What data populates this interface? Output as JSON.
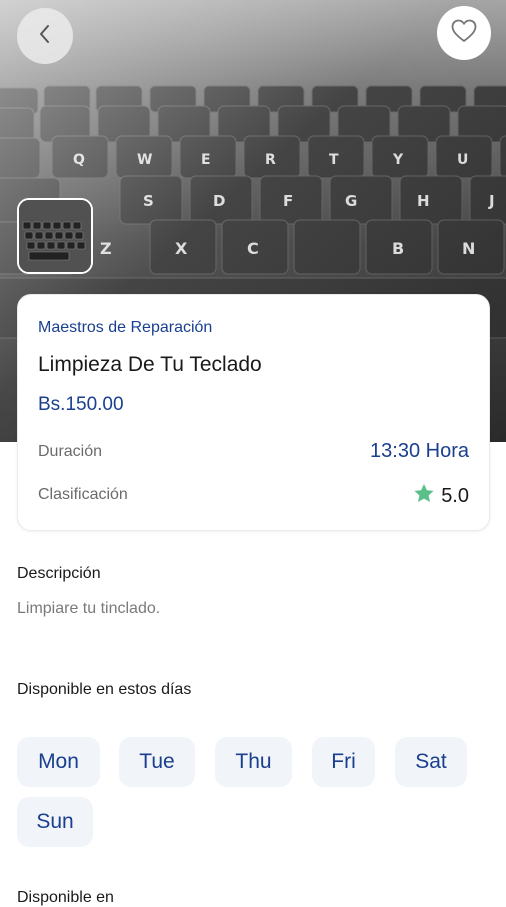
{
  "header": {
    "back_icon": "chevron-left-icon",
    "favorite_icon": "heart-outline-icon"
  },
  "service": {
    "provider": "Maestros de Reparación",
    "title": "Limpieza De Tu Teclado",
    "price": "Bs.150.00",
    "duration_label": "Duración",
    "duration_value": "13:30 Hora",
    "rating_label": "Clasificación",
    "rating_value": "5.0",
    "rating_icon": "star-icon"
  },
  "description": {
    "heading": "Descripción",
    "text": "Limpiare tu tinclado."
  },
  "availability": {
    "heading": "Disponible en estos días",
    "days": [
      "Mon",
      "Tue",
      "Thu",
      "Fri",
      "Sat",
      "Sun"
    ]
  },
  "location": {
    "heading": "Disponible en"
  },
  "colors": {
    "primary": "#1a3f8f",
    "star": "#5bbf8a",
    "chip_bg": "#f1f4f8"
  }
}
